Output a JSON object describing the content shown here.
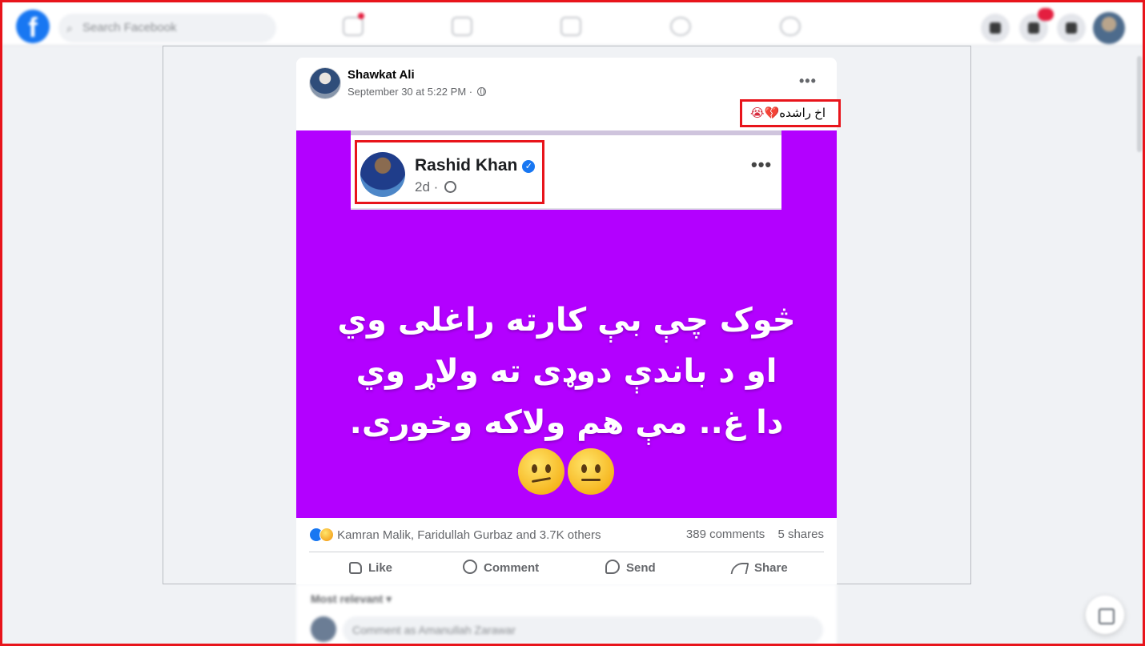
{
  "topbar": {
    "logo": "f",
    "search_placeholder": "Search Facebook",
    "icons": [
      "home-icon",
      "watch-icon",
      "marketplace-icon",
      "groups-icon",
      "gaming-icon",
      "menu-icon",
      "messenger-icon",
      "notifications-icon"
    ]
  },
  "post": {
    "author": "Shawkat Ali",
    "date": "September 30 at 5:22 PM ·",
    "caption": "اخ راشده",
    "caption_emoji": "💔😭",
    "more": "•••",
    "image": {
      "background": "#b300ff",
      "inner_post": {
        "author": "Rashid Khan",
        "verified": "✓",
        "time": "2d ·",
        "more": "•••"
      },
      "poem_lines": [
        "څوک چې بې کارته راغلی وي",
        "او د باندې دوډی ته ولاړ وي",
        "دا غ.. مې هم ولاکه وخوری."
      ],
      "emojis": [
        "confused-face-icon",
        "neutral-face-icon"
      ]
    },
    "reactions": {
      "names": "Kamran Malik, Faridullah Gurbaz and 3.7K others",
      "comments": "389 comments",
      "shares": "5 shares"
    },
    "actions": {
      "like": "Like",
      "comment": "Comment",
      "send": "Send",
      "share": "Share"
    }
  },
  "comments_section": {
    "sort_label": "Most relevant ▾",
    "input_placeholder": "Comment as Amanullah Zarawar"
  },
  "colors": {
    "facebook_blue": "#1877f2",
    "highlight_red": "#e8141b",
    "image_purple": "#b300ff"
  }
}
